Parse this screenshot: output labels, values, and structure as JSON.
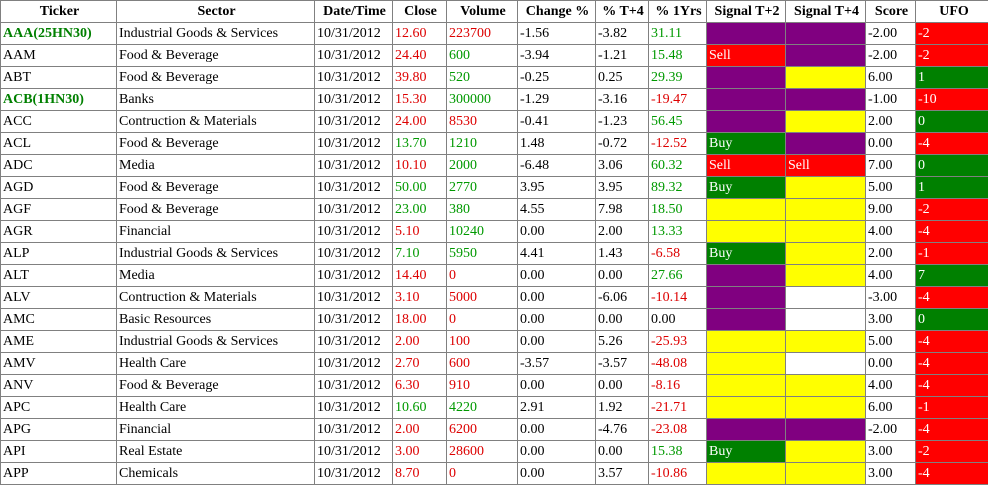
{
  "headers": [
    "Ticker",
    "Sector",
    "Date/Time",
    "Close",
    "Volume",
    "Change %",
    "% T+4",
    "% 1Yrs",
    "Signal T+2",
    "Signal T+4",
    "Score",
    "UFO"
  ],
  "colors": {
    "green_text": "#009900",
    "red_text": "#dd0000",
    "ticker_green": "#008000",
    "purple": "#800080",
    "yellow": "#ffff00",
    "red": "#ff0000",
    "green": "#008000"
  },
  "rows": [
    {
      "ticker": "AAA(25HN30)",
      "ticker_style": "green",
      "sector": "Industrial Goods & Services",
      "date": "10/31/2012",
      "close": "12.60",
      "close_c": "red",
      "volume": "223700",
      "volume_c": "red",
      "change": "-1.56",
      "t4": "-3.82",
      "y1": "31.11",
      "y1_c": "green",
      "sig2": "",
      "sig2_bg": "purple",
      "sig4": "",
      "sig4_bg": "purple",
      "score": "-2.00",
      "ufo": "-2",
      "ufo_bg": "red"
    },
    {
      "ticker": "AAM",
      "ticker_style": "black",
      "sector": "Food & Beverage",
      "date": "10/31/2012",
      "close": "24.40",
      "close_c": "red",
      "volume": "600",
      "volume_c": "green",
      "change": "-3.94",
      "t4": "-1.21",
      "y1": "15.48",
      "y1_c": "green",
      "sig2": "Sell",
      "sig2_bg": "red",
      "sig4": "",
      "sig4_bg": "purple",
      "score": "-2.00",
      "ufo": "-2",
      "ufo_bg": "red"
    },
    {
      "ticker": "ABT",
      "ticker_style": "black",
      "sector": "Food & Beverage",
      "date": "10/31/2012",
      "close": "39.80",
      "close_c": "red",
      "volume": "520",
      "volume_c": "green",
      "change": "-0.25",
      "t4": "0.25",
      "y1": "29.39",
      "y1_c": "green",
      "sig2": "",
      "sig2_bg": "purple",
      "sig4": "",
      "sig4_bg": "yellow",
      "score": "6.00",
      "ufo": "1",
      "ufo_bg": "green"
    },
    {
      "ticker": "ACB(1HN30)",
      "ticker_style": "green",
      "sector": "Banks",
      "date": "10/31/2012",
      "close": "15.30",
      "close_c": "red",
      "volume": "300000",
      "volume_c": "green",
      "change": "-1.29",
      "t4": "-3.16",
      "y1": "-19.47",
      "y1_c": "red",
      "sig2": "",
      "sig2_bg": "purple",
      "sig4": "",
      "sig4_bg": "purple",
      "score": "-1.00",
      "ufo": "-10",
      "ufo_bg": "red"
    },
    {
      "ticker": "ACC",
      "ticker_style": "black",
      "sector": "Contruction & Materials",
      "date": "10/31/2012",
      "close": "24.00",
      "close_c": "red",
      "volume": "8530",
      "volume_c": "red",
      "change": "-0.41",
      "t4": "-1.23",
      "y1": "56.45",
      "y1_c": "green",
      "sig2": "",
      "sig2_bg": "purple",
      "sig4": "",
      "sig4_bg": "yellow",
      "score": "2.00",
      "ufo": "0",
      "ufo_bg": "green"
    },
    {
      "ticker": "ACL",
      "ticker_style": "black",
      "sector": "Food & Beverage",
      "date": "10/31/2012",
      "close": "13.70",
      "close_c": "green",
      "volume": "1210",
      "volume_c": "green",
      "change": "1.48",
      "t4": "-0.72",
      "y1": "-12.52",
      "y1_c": "red",
      "sig2": "Buy",
      "sig2_bg": "green",
      "sig4": "",
      "sig4_bg": "purple",
      "score": "0.00",
      "ufo": "-4",
      "ufo_bg": "red"
    },
    {
      "ticker": "ADC",
      "ticker_style": "black",
      "sector": "Media",
      "date": "10/31/2012",
      "close": "10.10",
      "close_c": "red",
      "volume": "2000",
      "volume_c": "green",
      "change": "-6.48",
      "t4": "3.06",
      "y1": "60.32",
      "y1_c": "green",
      "sig2": "Sell",
      "sig2_bg": "red",
      "sig4": "Sell",
      "sig4_bg": "red",
      "score": "7.00",
      "ufo": "0",
      "ufo_bg": "green"
    },
    {
      "ticker": "AGD",
      "ticker_style": "black",
      "sector": "Food & Beverage",
      "date": "10/31/2012",
      "close": "50.00",
      "close_c": "green",
      "volume": "2770",
      "volume_c": "green",
      "change": "3.95",
      "t4": "3.95",
      "y1": "89.32",
      "y1_c": "green",
      "sig2": "Buy",
      "sig2_bg": "green",
      "sig4": "",
      "sig4_bg": "yellow",
      "score": "5.00",
      "ufo": "1",
      "ufo_bg": "green"
    },
    {
      "ticker": "AGF",
      "ticker_style": "black",
      "sector": "Food & Beverage",
      "date": "10/31/2012",
      "close": "23.00",
      "close_c": "green",
      "volume": "380",
      "volume_c": "green",
      "change": "4.55",
      "t4": "7.98",
      "y1": "18.50",
      "y1_c": "green",
      "sig2": "",
      "sig2_bg": "yellow",
      "sig4": "",
      "sig4_bg": "yellow",
      "score": "9.00",
      "ufo": "-2",
      "ufo_bg": "red"
    },
    {
      "ticker": "AGR",
      "ticker_style": "black",
      "sector": "Financial",
      "date": "10/31/2012",
      "close": "5.10",
      "close_c": "red",
      "volume": "10240",
      "volume_c": "green",
      "change": "0.00",
      "t4": "2.00",
      "y1": "13.33",
      "y1_c": "green",
      "sig2": "",
      "sig2_bg": "yellow",
      "sig4": "",
      "sig4_bg": "yellow",
      "score": "4.00",
      "ufo": "-4",
      "ufo_bg": "red"
    },
    {
      "ticker": "ALP",
      "ticker_style": "black",
      "sector": "Industrial Goods & Services",
      "date": "10/31/2012",
      "close": "7.10",
      "close_c": "green",
      "volume": "5950",
      "volume_c": "green",
      "change": "4.41",
      "t4": "1.43",
      "y1": "-6.58",
      "y1_c": "red",
      "sig2": "Buy",
      "sig2_bg": "green",
      "sig4": "",
      "sig4_bg": "yellow",
      "score": "2.00",
      "ufo": "-1",
      "ufo_bg": "red"
    },
    {
      "ticker": "ALT",
      "ticker_style": "black",
      "sector": "Media",
      "date": "10/31/2012",
      "close": "14.40",
      "close_c": "red",
      "volume": "0",
      "volume_c": "red",
      "change": "0.00",
      "t4": "0.00",
      "y1": "27.66",
      "y1_c": "green",
      "sig2": "",
      "sig2_bg": "purple",
      "sig4": "",
      "sig4_bg": "yellow",
      "score": "4.00",
      "ufo": "7",
      "ufo_bg": "green"
    },
    {
      "ticker": "ALV",
      "ticker_style": "black",
      "sector": "Contruction & Materials",
      "date": "10/31/2012",
      "close": "3.10",
      "close_c": "red",
      "volume": "5000",
      "volume_c": "red",
      "change": "0.00",
      "t4": "-6.06",
      "y1": "-10.14",
      "y1_c": "red",
      "sig2": "",
      "sig2_bg": "purple",
      "sig4": "",
      "sig4_bg": "white",
      "score": "-3.00",
      "ufo": "-4",
      "ufo_bg": "red"
    },
    {
      "ticker": "AMC",
      "ticker_style": "black",
      "sector": "Basic Resources",
      "date": "10/31/2012",
      "close": "18.00",
      "close_c": "red",
      "volume": "0",
      "volume_c": "red",
      "change": "0.00",
      "t4": "0.00",
      "y1": "0.00",
      "y1_c": "black",
      "sig2": "",
      "sig2_bg": "purple",
      "sig4": "",
      "sig4_bg": "white",
      "score": "3.00",
      "ufo": "0",
      "ufo_bg": "green"
    },
    {
      "ticker": "AME",
      "ticker_style": "black",
      "sector": "Industrial Goods & Services",
      "date": "10/31/2012",
      "close": "2.00",
      "close_c": "red",
      "volume": "100",
      "volume_c": "red",
      "change": "0.00",
      "t4": "5.26",
      "y1": "-25.93",
      "y1_c": "red",
      "sig2": "",
      "sig2_bg": "yellow",
      "sig4": "",
      "sig4_bg": "yellow",
      "score": "5.00",
      "ufo": "-4",
      "ufo_bg": "red"
    },
    {
      "ticker": "AMV",
      "ticker_style": "black",
      "sector": "Health Care",
      "date": "10/31/2012",
      "close": "2.70",
      "close_c": "red",
      "volume": "600",
      "volume_c": "red",
      "change": "-3.57",
      "t4": "-3.57",
      "y1": "-48.08",
      "y1_c": "red",
      "sig2": "",
      "sig2_bg": "yellow",
      "sig4": "",
      "sig4_bg": "white",
      "score": "0.00",
      "ufo": "-4",
      "ufo_bg": "red"
    },
    {
      "ticker": "ANV",
      "ticker_style": "black",
      "sector": "Food & Beverage",
      "date": "10/31/2012",
      "close": "6.30",
      "close_c": "red",
      "volume": "910",
      "volume_c": "red",
      "change": "0.00",
      "t4": "0.00",
      "y1": "-8.16",
      "y1_c": "red",
      "sig2": "",
      "sig2_bg": "yellow",
      "sig4": "",
      "sig4_bg": "yellow",
      "score": "4.00",
      "ufo": "-4",
      "ufo_bg": "red"
    },
    {
      "ticker": "APC",
      "ticker_style": "black",
      "sector": "Health Care",
      "date": "10/31/2012",
      "close": "10.60",
      "close_c": "green",
      "volume": "4220",
      "volume_c": "green",
      "change": "2.91",
      "t4": "1.92",
      "y1": "-21.71",
      "y1_c": "red",
      "sig2": "",
      "sig2_bg": "yellow",
      "sig4": "",
      "sig4_bg": "yellow",
      "score": "6.00",
      "ufo": "-1",
      "ufo_bg": "red"
    },
    {
      "ticker": "APG",
      "ticker_style": "black",
      "sector": "Financial",
      "date": "10/31/2012",
      "close": "2.00",
      "close_c": "red",
      "volume": "6200",
      "volume_c": "red",
      "change": "0.00",
      "t4": "-4.76",
      "y1": "-23.08",
      "y1_c": "red",
      "sig2": "",
      "sig2_bg": "purple",
      "sig4": "",
      "sig4_bg": "purple",
      "score": "-2.00",
      "ufo": "-4",
      "ufo_bg": "red"
    },
    {
      "ticker": "API",
      "ticker_style": "black",
      "sector": "Real Estate",
      "date": "10/31/2012",
      "close": "3.00",
      "close_c": "red",
      "volume": "28600",
      "volume_c": "red",
      "change": "0.00",
      "t4": "0.00",
      "y1": "15.38",
      "y1_c": "green",
      "sig2": "Buy",
      "sig2_bg": "green",
      "sig4": "",
      "sig4_bg": "yellow",
      "score": "3.00",
      "ufo": "-2",
      "ufo_bg": "red"
    },
    {
      "ticker": "APP",
      "ticker_style": "black",
      "sector": "Chemicals",
      "date": "10/31/2012",
      "close": "8.70",
      "close_c": "red",
      "volume": "0",
      "volume_c": "red",
      "change": "0.00",
      "t4": "3.57",
      "y1": "-10.86",
      "y1_c": "red",
      "sig2": "",
      "sig2_bg": "yellow",
      "sig4": "",
      "sig4_bg": "yellow",
      "score": "3.00",
      "ufo": "-4",
      "ufo_bg": "red"
    }
  ]
}
